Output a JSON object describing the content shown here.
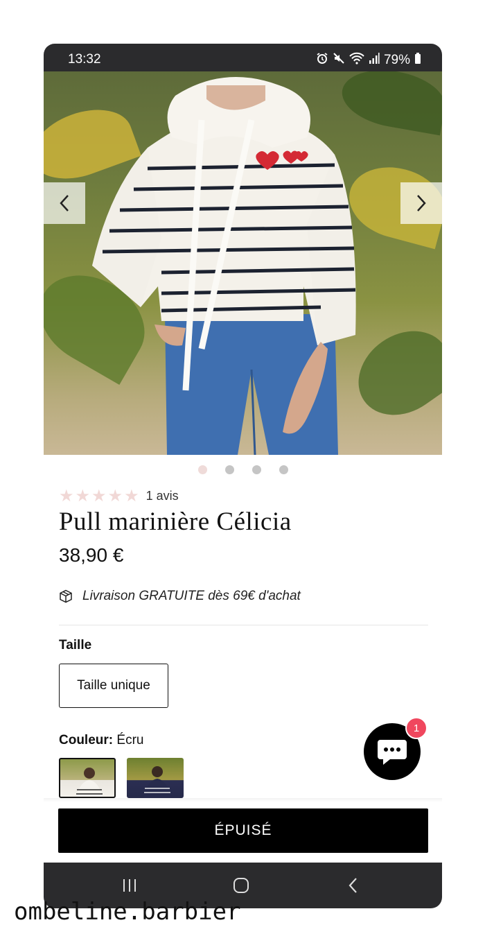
{
  "status_bar": {
    "time": "13:32",
    "battery": "79%",
    "icons": [
      "alarm-icon",
      "mute-icon",
      "wifi-icon",
      "signal-icon",
      "battery-icon"
    ]
  },
  "gallery": {
    "dots_count": 4,
    "active_dot": 0,
    "prev_icon": "chevron-left-icon",
    "next_icon": "chevron-right-icon"
  },
  "product": {
    "rating_stars": 5,
    "reviews": "1 avis",
    "title": "Pull marinière Célicia",
    "price": "38,90 €",
    "shipping": "Livraison GRATUITE dès 69€ d'achat",
    "size_label": "Taille",
    "size_option": "Taille unique",
    "color_label": "Couleur:",
    "color_value": "Écru"
  },
  "chat": {
    "badge_count": "1"
  },
  "cta": {
    "label": "ÉPUISÉ"
  },
  "watermark": "ombeline.barbier",
  "colors": {
    "status_bar": "#2b2b2d",
    "star": "#f1d8d6",
    "badge": "#f0475e",
    "button": "#000000"
  }
}
